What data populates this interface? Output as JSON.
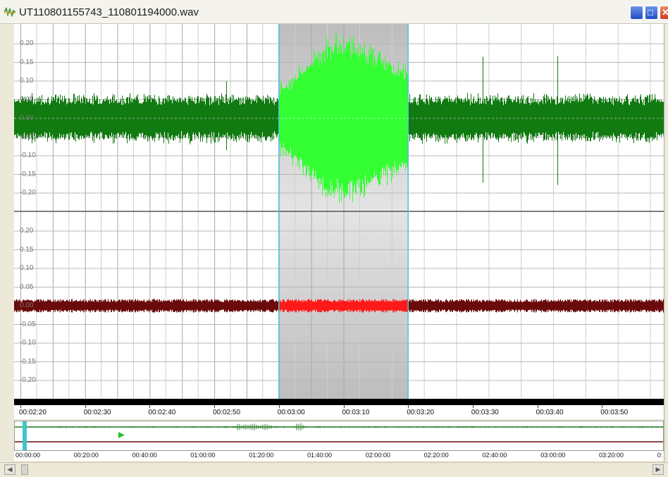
{
  "window": {
    "title": "UT110801155743_110801194000.wav",
    "icon": "waveform-app-icon",
    "buttons": [
      "minimize",
      "maximize",
      "close"
    ]
  },
  "channels": [
    {
      "name": "",
      "y_ticks": [
        "0.20",
        "0.15",
        "0.10",
        "0.05",
        "0.00",
        "-0.05",
        "-0.10",
        "-0.15",
        "-0.20"
      ],
      "color": "#117a11",
      "selected_color": "#33ff33"
    },
    {
      "name": "",
      "y_ticks": [
        "0.20",
        "0.15",
        "0.10",
        "0.05",
        "0.00",
        "-0.05",
        "-0.10",
        "-0.15",
        "-0.20"
      ],
      "color": "#6a0a0a",
      "selected_color": "#ff1a1a"
    }
  ],
  "selection": {
    "start": "00:03:00",
    "end": "00:03:20",
    "color": "#cccccc"
  },
  "time_axis": {
    "labels": [
      "00:02:20",
      "00:02:30",
      "00:02:40",
      "00:02:50",
      "00:03:00",
      "00:03:10",
      "00:03:20",
      "00:03:30",
      "00:03:40",
      "00:03:50"
    ]
  },
  "overview": {
    "labels": [
      "00:00:00",
      "00:20:00",
      "00:40:00",
      "01:00:00",
      "01:20:00",
      "01:40:00",
      "02:00:00",
      "02:20:00",
      "02:40:00",
      "03:00:00",
      "03:20:00",
      "0:"
    ],
    "play_marker_icon": "play-triangle-icon",
    "position_marker_color": "#3fc6cc"
  },
  "scrollbar": {
    "left_icon": "scroll-left-arrow-icon",
    "right_icon": "scroll-right-arrow-icon"
  }
}
